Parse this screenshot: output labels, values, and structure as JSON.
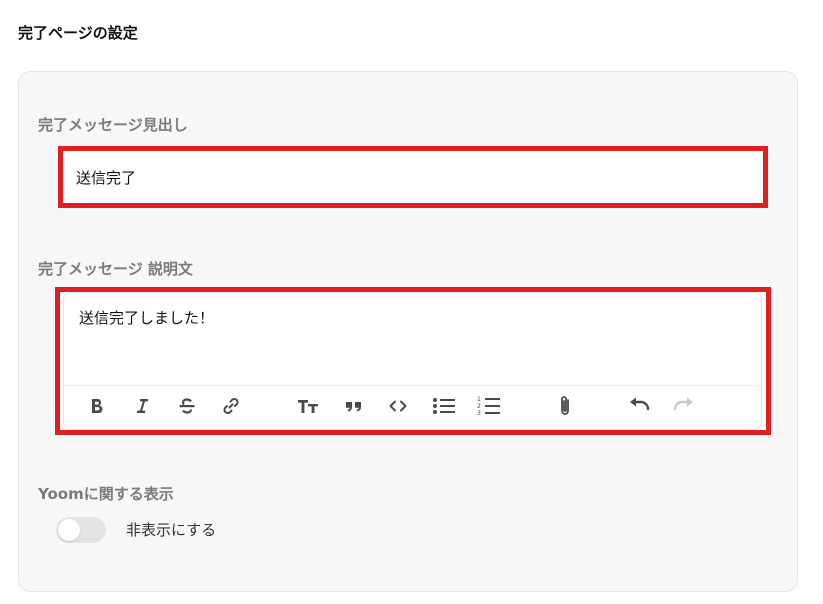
{
  "section": {
    "title": "完了ページの設定"
  },
  "heading_field": {
    "label": "完了メッセージ見出し",
    "value": "送信完了"
  },
  "description_field": {
    "label": "完了メッセージ 説明文",
    "value": "送信完了しました！",
    "toolbar": [
      {
        "icon": "bold-icon"
      },
      {
        "icon": "italic-icon"
      },
      {
        "icon": "strikethrough-icon"
      },
      {
        "icon": "link-icon"
      },
      {
        "icon": "text-size-icon"
      },
      {
        "icon": "quote-icon"
      },
      {
        "icon": "code-icon"
      },
      {
        "icon": "bullet-list-icon"
      },
      {
        "icon": "numbered-list-icon"
      },
      {
        "icon": "attachment-icon"
      },
      {
        "icon": "undo-icon"
      },
      {
        "icon": "redo-icon",
        "disabled": true
      }
    ]
  },
  "yoom_display": {
    "label": "Yoomに関する表示",
    "toggle_label": "非表示にする",
    "toggle_on": false
  },
  "colors": {
    "highlight": "#e02020",
    "card_bg": "#f7f7f7",
    "label": "#7a7a7a"
  }
}
